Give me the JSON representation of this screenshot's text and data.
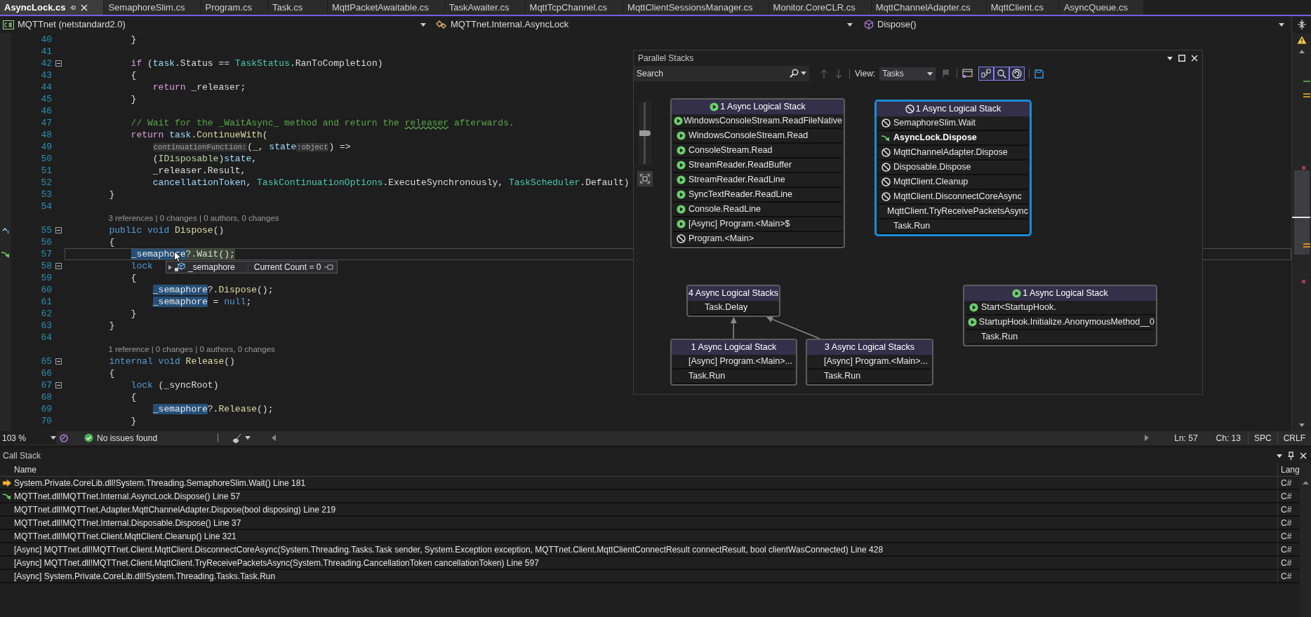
{
  "tabs": [
    {
      "label": "AsyncLock.cs",
      "selected": true
    },
    {
      "label": "SemaphoreSlim.cs",
      "selected": false
    },
    {
      "label": "Program.cs",
      "selected": false
    },
    {
      "label": "Task.cs",
      "selected": false
    },
    {
      "label": "MqttPacketAwaitable.cs",
      "selected": false
    },
    {
      "label": "TaskAwaiter.cs",
      "selected": false
    },
    {
      "label": "MqttTcpChannel.cs",
      "selected": false
    },
    {
      "label": "MqttClientSessionsManager.cs",
      "selected": false
    },
    {
      "label": "Monitor.CoreCLR.cs",
      "selected": false
    },
    {
      "label": "MqttChannelAdapter.cs",
      "selected": false
    },
    {
      "label": "MqttClient.cs",
      "selected": false
    },
    {
      "label": "AsyncQueue.cs",
      "selected": false
    }
  ],
  "navigation": {
    "project": "MQTTnet (netstandard2.0)",
    "type": "MQTTnet.Internal.AsyncLock",
    "member": "Dispose()"
  },
  "editor": {
    "lines": [
      {
        "kind": "code",
        "n": "40",
        "fold": false,
        "current": false,
        "code": [
          {
            "text": "            }",
            "kind": "plain"
          }
        ]
      },
      {
        "kind": "code",
        "n": "41",
        "fold": false,
        "current": false
      },
      {
        "kind": "code",
        "n": "42",
        "fold": true,
        "current": false,
        "code": [
          {
            "text": "            if",
            "kind": "ctl"
          },
          {
            "text": " (",
            "kind": "plain"
          },
          {
            "text": "task",
            "kind": "var"
          },
          {
            "text": ".Status == ",
            "kind": "plain"
          },
          {
            "text": "TaskStatus",
            "kind": "type"
          },
          {
            "text": ".RanToCompletion)",
            "kind": "plain"
          }
        ]
      },
      {
        "kind": "code",
        "n": "43",
        "fold": false,
        "current": false,
        "code": [
          {
            "text": "            {",
            "kind": "plain"
          }
        ]
      },
      {
        "kind": "code",
        "n": "44",
        "fold": false,
        "current": false,
        "code": [
          {
            "text": "                return",
            "kind": "ctl"
          },
          {
            "text": " _releaser;",
            "kind": "plain"
          }
        ]
      },
      {
        "kind": "code",
        "n": "45",
        "fold": false,
        "current": false,
        "code": [
          {
            "text": "            }",
            "kind": "plain"
          }
        ]
      },
      {
        "kind": "code",
        "n": "46",
        "fold": false,
        "current": false
      },
      {
        "kind": "code",
        "n": "47",
        "fold": false,
        "current": false,
        "code": [
          {
            "text": "            // Wait for the _WaitAsync_ method and return the ",
            "kind": "comment"
          },
          {
            "text": "releaser",
            "kind": "squiggle"
          },
          {
            "text": " afterwards.",
            "kind": "comment"
          }
        ]
      },
      {
        "kind": "code",
        "n": "48",
        "fold": false,
        "current": false,
        "code": [
          {
            "text": "            return",
            "kind": "ctl"
          },
          {
            "text": " task",
            "kind": "var"
          },
          {
            "text": ".",
            "kind": "plain"
          },
          {
            "text": "ContinueWith",
            "kind": "method"
          },
          {
            "text": "(",
            "kind": "plain"
          }
        ]
      },
      {
        "kind": "code",
        "n": "49",
        "fold": false,
        "current": false,
        "code": [
          {
            "text": "                continuationFunction:",
            "kind": "hint"
          },
          {
            "text": "(_, ",
            "kind": "plain"
          },
          {
            "text": "state",
            "kind": "var"
          },
          {
            "text": ":object",
            "kind": "hint"
          },
          {
            "text": ") =>",
            "kind": "plain"
          }
        ]
      },
      {
        "kind": "code",
        "n": "50",
        "fold": false,
        "current": false,
        "code": [
          {
            "text": "                (",
            "kind": "plain"
          },
          {
            "text": "IDisposable",
            "kind": "iface"
          },
          {
            "text": ")",
            "kind": "plain"
          },
          {
            "text": "state",
            "kind": "var"
          },
          {
            "text": ",",
            "kind": "plain"
          }
        ]
      },
      {
        "kind": "code",
        "n": "51",
        "fold": false,
        "current": false,
        "code": [
          {
            "text": "                _releaser.Result,",
            "kind": "plain"
          }
        ]
      },
      {
        "kind": "code",
        "n": "52",
        "fold": false,
        "current": false,
        "code": [
          {
            "text": "                cancellationToken",
            "kind": "var"
          },
          {
            "text": ", ",
            "kind": "plain"
          },
          {
            "text": "TaskContinuationOptions",
            "kind": "type"
          },
          {
            "text": ".ExecuteSynchronously, ",
            "kind": "plain"
          },
          {
            "text": "TaskScheduler",
            "kind": "type"
          },
          {
            "text": ".Default)",
            "kind": "plain"
          }
        ]
      },
      {
        "kind": "code",
        "n": "53",
        "fold": false,
        "current": false,
        "code": [
          {
            "text": "        }",
            "kind": "plain"
          }
        ]
      },
      {
        "kind": "code",
        "n": "54",
        "fold": false,
        "current": false
      },
      {
        "kind": "lens",
        "text": "3 references | 0 changes | 0 authors, 0 changes"
      },
      {
        "kind": "code",
        "n": "55",
        "fold": true,
        "current": false,
        "margin": {
          "kind": "caret"
        },
        "code": [
          {
            "text": "        public void",
            "kind": "kw"
          },
          {
            "text": " Dispose",
            "kind": "method"
          },
          {
            "text": "()",
            "kind": "plain"
          }
        ]
      },
      {
        "kind": "code",
        "n": "56",
        "fold": false,
        "current": false,
        "code": [
          {
            "text": "        {",
            "kind": "plain"
          }
        ]
      },
      {
        "kind": "code",
        "n": "57",
        "fold": false,
        "current": true,
        "margin": {
          "kind": "next-statement"
        },
        "code": [
          {
            "text": "            _semaphore",
            "kind": "ref"
          },
          {
            "text": "?.Wait();",
            "kind": "stmt"
          }
        ]
      },
      {
        "kind": "code",
        "n": "58",
        "fold": true,
        "current": false,
        "code": [
          {
            "text": "            lock",
            "kind": "kw"
          }
        ],
        "datatip": {
          "name": "_semaphore",
          "value": "Current Count = 0"
        }
      },
      {
        "kind": "code",
        "n": "59",
        "fold": false,
        "current": false,
        "code": [
          {
            "text": "            {",
            "kind": "plain"
          }
        ]
      },
      {
        "kind": "code",
        "n": "60",
        "fold": false,
        "current": false,
        "code": [
          {
            "text": "                _semaphore",
            "kind": "ref"
          },
          {
            "text": "?.",
            "kind": "plain"
          },
          {
            "text": "Dispose",
            "kind": "method"
          },
          {
            "text": "();",
            "kind": "plain"
          }
        ]
      },
      {
        "kind": "code",
        "n": "61",
        "fold": false,
        "current": false,
        "code": [
          {
            "text": "                _semaphore",
            "kind": "ref"
          },
          {
            "text": " = ",
            "kind": "plain"
          },
          {
            "text": "null",
            "kind": "kw"
          },
          {
            "text": ";",
            "kind": "plain"
          }
        ]
      },
      {
        "kind": "code",
        "n": "62",
        "fold": false,
        "current": false,
        "code": [
          {
            "text": "            }",
            "kind": "plain"
          }
        ]
      },
      {
        "kind": "code",
        "n": "63",
        "fold": false,
        "current": false,
        "code": [
          {
            "text": "        }",
            "kind": "plain"
          }
        ]
      },
      {
        "kind": "code",
        "n": "64",
        "fold": false,
        "current": false
      },
      {
        "kind": "lens",
        "text": "1 reference | 0 changes | 0 authors, 0 changes"
      },
      {
        "kind": "code",
        "n": "65",
        "fold": true,
        "current": false,
        "code": [
          {
            "text": "        internal void",
            "kind": "kw"
          },
          {
            "text": " Release",
            "kind": "method"
          },
          {
            "text": "()",
            "kind": "plain"
          }
        ]
      },
      {
        "kind": "code",
        "n": "66",
        "fold": false,
        "current": false,
        "code": [
          {
            "text": "        {",
            "kind": "plain"
          }
        ]
      },
      {
        "kind": "code",
        "n": "67",
        "fold": true,
        "current": false,
        "code": [
          {
            "text": "            lock",
            "kind": "kw"
          },
          {
            "text": " (_syncRoot)",
            "kind": "plain"
          }
        ]
      },
      {
        "kind": "code",
        "n": "68",
        "fold": false,
        "current": false,
        "code": [
          {
            "text": "            {",
            "kind": "plain"
          }
        ]
      },
      {
        "kind": "code",
        "n": "69",
        "fold": false,
        "current": false,
        "code": [
          {
            "text": "                _semaphore",
            "kind": "ref"
          },
          {
            "text": "?.",
            "kind": "plain"
          },
          {
            "text": "Release",
            "kind": "method"
          },
          {
            "text": "();",
            "kind": "plain"
          }
        ]
      },
      {
        "kind": "code",
        "n": "70",
        "fold": false,
        "current": false,
        "code": [
          {
            "text": "            }",
            "kind": "plain"
          }
        ]
      }
    ]
  },
  "status_bar": {
    "zoom": "103 %",
    "issues": "No issues found",
    "line": "Ln: 57",
    "column": "Ch: 13",
    "whitespace": "SPC",
    "line_endings": "CRLF"
  },
  "parallel_stacks": {
    "title": "Parallel Stacks",
    "search": {
      "placeholder": "Search"
    },
    "arrows_disabled": true,
    "view_label": "View:",
    "view": "Tasks",
    "toggles": [
      {
        "selected": true
      },
      {
        "selected": true
      },
      {
        "selected": true
      }
    ],
    "zoom": {
      "level": 0.5
    },
    "nodes": [
      {
        "header": "1 Async Logical Stack",
        "kind": "running",
        "selected": false,
        "frames": [
          {
            "kind": "running",
            "text": "WindowsConsoleStream.ReadFileNative"
          },
          {
            "kind": "running",
            "text": "WindowsConsoleStream.Read"
          },
          {
            "kind": "running",
            "text": "ConsoleStream.Read"
          },
          {
            "kind": "running",
            "text": "StreamReader.ReadBuffer"
          },
          {
            "kind": "running",
            "text": "StreamReader.ReadLine"
          },
          {
            "kind": "running",
            "text": "SyncTextReader.ReadLine"
          },
          {
            "kind": "running",
            "text": "Console.ReadLine"
          },
          {
            "kind": "running",
            "text": "[Async] Program.<Main>$"
          },
          {
            "kind": "blocked",
            "text": "Program.<Main>"
          }
        ]
      },
      {
        "header": "1 Async Logical Stack",
        "kind": "blocked",
        "selected": true,
        "frames": [
          {
            "kind": "blocked",
            "text": "SemaphoreSlim.Wait"
          },
          {
            "kind": "current",
            "text": "AsyncLock.Dispose"
          },
          {
            "kind": "blocked",
            "text": "MqttChannelAdapter.Dispose"
          },
          {
            "kind": "blocked",
            "text": "Disposable.Dispose"
          },
          {
            "kind": "blocked",
            "text": "MqttClient.Cleanup"
          },
          {
            "kind": "blocked",
            "text": "MqttClient.DisconnectCoreAsync"
          },
          {
            "text": "MqttClient.TryReceivePacketsAsync"
          },
          {
            "text": "Task.Run"
          }
        ]
      },
      {
        "header": "4 Async Logical Stacks",
        "selected": false,
        "frames": [
          {
            "text": "Task.Delay"
          }
        ],
        "children": [
          {
            "header": "1 Async Logical Stack",
            "selected": false,
            "frames": [
              {
                "text": "[Async] Program.<Main>..."
              },
              {
                "text": "Task.Run"
              }
            ]
          },
          {
            "header": "3 Async Logical Stacks",
            "selected": false,
            "frames": [
              {
                "text": "[Async] Program.<Main>..."
              },
              {
                "text": "Task.Run"
              }
            ]
          }
        ]
      },
      {
        "header": "1 Async Logical Stack",
        "kind": "running",
        "selected": false,
        "frames": [
          {
            "kind": "running",
            "text": "Start<StartupHook."
          },
          {
            "kind": "running",
            "text": "StartupHook.Initialize.AnonymousMethod__0"
          },
          {
            "text": "Task.Run"
          }
        ]
      }
    ]
  },
  "call_stack": {
    "title": "Call Stack",
    "columns": [
      "Name",
      "Lang"
    ],
    "rows": [
      {
        "kind": "current",
        "name": "System.Private.CoreLib.dll!System.Threading.SemaphoreSlim.Wait() Line 181",
        "lang": "C#"
      },
      {
        "kind": "return",
        "name": "MQTTnet.dll!MQTTnet.Internal.AsyncLock.Dispose() Line 57",
        "lang": "C#"
      },
      {
        "kind": "plain",
        "name": "MQTTnet.dll!MQTTnet.Adapter.MqttChannelAdapter.Dispose(bool disposing) Line 219",
        "lang": "C#"
      },
      {
        "kind": "plain",
        "name": "MQTTnet.dll!MQTTnet.Internal.Disposable.Dispose() Line 37",
        "lang": "C#"
      },
      {
        "kind": "plain",
        "name": "MQTTnet.dll!MQTTnet.Client.MqttClient.Cleanup() Line 321",
        "lang": "C#"
      },
      {
        "kind": "plain",
        "name": "[Async] MQTTnet.dll!MQTTnet.Client.MqttClient.DisconnectCoreAsync(System.Threading.Tasks.Task sender, System.Exception exception, MQTTnet.Client.MqttClientConnectResult connectResult, bool clientWasConnected) Line 428",
        "lang": "C#"
      },
      {
        "kind": "plain",
        "name": "[Async] MQTTnet.dll!MQTTnet.Client.MqttClient.TryReceivePacketsAsync(System.Threading.CancellationToken cancellationToken) Line 597",
        "lang": "C#"
      },
      {
        "kind": "plain",
        "name": "[Async] System.Private.CoreLib.dll!System.Threading.Tasks.Task.Run",
        "lang": "C#"
      }
    ]
  }
}
